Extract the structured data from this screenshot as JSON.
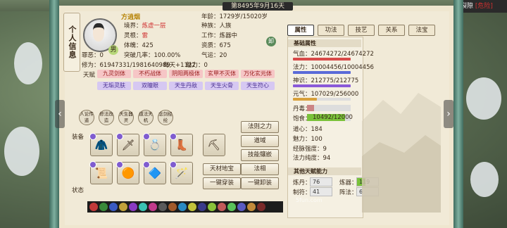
{
  "header": {
    "date": "第8495年9月16天"
  },
  "side_tab": {
    "label": "个人信息"
  },
  "map_widget": {
    "label": "裂隙",
    "danger": "[危险]"
  },
  "character": {
    "name": "方逍烟",
    "gender": "男",
    "realm_label": "境界：",
    "realm_value": "炼虚一层",
    "root_label": "灵根：",
    "root_value": "雷",
    "physique_label": "体魄：",
    "physique_value": "425",
    "evil_label": "罪恶：",
    "evil_value": "0",
    "break_label": "突破几率：",
    "break_value": "100.00%",
    "cultivation_label": "修为：",
    "cultivation_value": "61947331/1981640989",
    "daily_label": "每天+",
    "daily_value": "1122",
    "charm_label": "魅力：",
    "charm_value": "0",
    "age_label": "年龄：",
    "age_value": "1729岁/15020岁",
    "race_label": "种族：",
    "race_value": "人族",
    "job_label": "工作：",
    "job_value": "炼器中",
    "talent_label": "资质：",
    "talent_value": "675",
    "luck_label": "气运：",
    "luck_value": "20",
    "destiny_badge": "卸"
  },
  "aptitudes": {
    "label": "天赋",
    "items": [
      {
        "text": "九灵剑体",
        "style": "red"
      },
      {
        "text": "不朽战体",
        "style": "red"
      },
      {
        "text": "阴阳两极体",
        "style": "red"
      },
      {
        "text": "玄甲不灭体",
        "style": "red"
      },
      {
        "text": "万化玄元体",
        "style": "red"
      },
      {
        "text": "无垢灵肤",
        "style": "pur"
      },
      {
        "text": "双瞳眼",
        "style": "pur"
      },
      {
        "text": "天生丹敌",
        "style": "pur"
      },
      {
        "text": "天生火骨",
        "style": "pur"
      },
      {
        "text": "天生符心",
        "style": "pur"
      }
    ]
  },
  "actions": [
    {
      "text": "人论传道"
    },
    {
      "text": "修法改造"
    },
    {
      "text": "天生器灵"
    },
    {
      "text": "道法天机"
    },
    {
      "text": "念剑经纶"
    }
  ],
  "equip": {
    "label": "装备",
    "status_label": "状态"
  },
  "buttons": {
    "law": "法则之力",
    "dao": "道域",
    "skill": "技能镶嵌",
    "treasure": "天材地宝",
    "phase": "法相",
    "wear_all": "一键穿装",
    "remove_all": "一键卸装"
  },
  "tabs": [
    "属性",
    "功法",
    "技艺",
    "关系",
    "法宝"
  ],
  "basic": {
    "title": "基础属性",
    "qixue_label": "气血：",
    "qixue_value": "24674272/24674272",
    "fali_label": "法力：",
    "fali_value": "10004456/10004456",
    "shenshi_label": "神识：",
    "shenshi_value": "212775/212775",
    "yuanqi_label": "元气：",
    "yuanqi_value": "107029/256000",
    "dandu_label": "丹毒：",
    "dandu_value": "1692/10000",
    "baoshi_label": "饱食：",
    "baoshi_value": "10492/12000",
    "daoxin_label": "道心：",
    "daoxin_value": "184",
    "meili_label": "魅力：",
    "meili_value": "100",
    "jingmai_label": "经脉强度：",
    "jingmai_value": "9",
    "fali_chun_label": "法力纯度：",
    "fali_chun_value": "94",
    "qixue_pct": 1.0,
    "fali_pct": 1.0,
    "shenshi_pct": 1.0,
    "yuanqi_pct": 0.418,
    "dandu_pct": 0.169,
    "baoshi_pct": 0.874
  },
  "other": {
    "title": "其他天赋能力",
    "liandan_label": "炼丹：",
    "liandan_value": "76",
    "lianqi_label": "炼器：",
    "lianqi_value": "119",
    "zhifu_label": "制符：",
    "zhifu_value": "41",
    "zhenfa_label": "阵法：",
    "zhenfa_value": "6"
  },
  "watermark": "5fun.com"
}
